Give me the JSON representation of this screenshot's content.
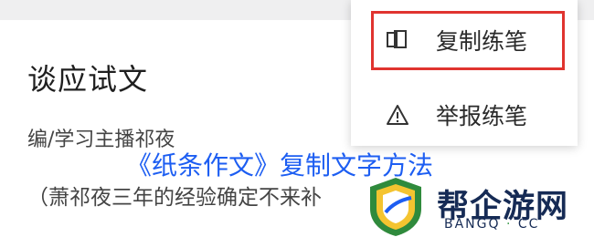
{
  "document": {
    "title": "谈应试文",
    "author": "编/学习主播祁夜",
    "excerpt": "（萧祁夜三年的经验确定不来补"
  },
  "context_menu": {
    "items": [
      {
        "label": "复制练笔",
        "icon": "copy-icon",
        "highlighted": true
      },
      {
        "label": "举报练笔",
        "icon": "warning-icon"
      }
    ],
    "highlight_color": "#e0342f"
  },
  "overlay": {
    "title": "《纸条作文》复制文字方法",
    "color": "#1d5ef2"
  },
  "watermark": {
    "name": "帮企游网",
    "sub_left": "BANGQ",
    "sub_dot": "·",
    "sub_right": "CC"
  }
}
